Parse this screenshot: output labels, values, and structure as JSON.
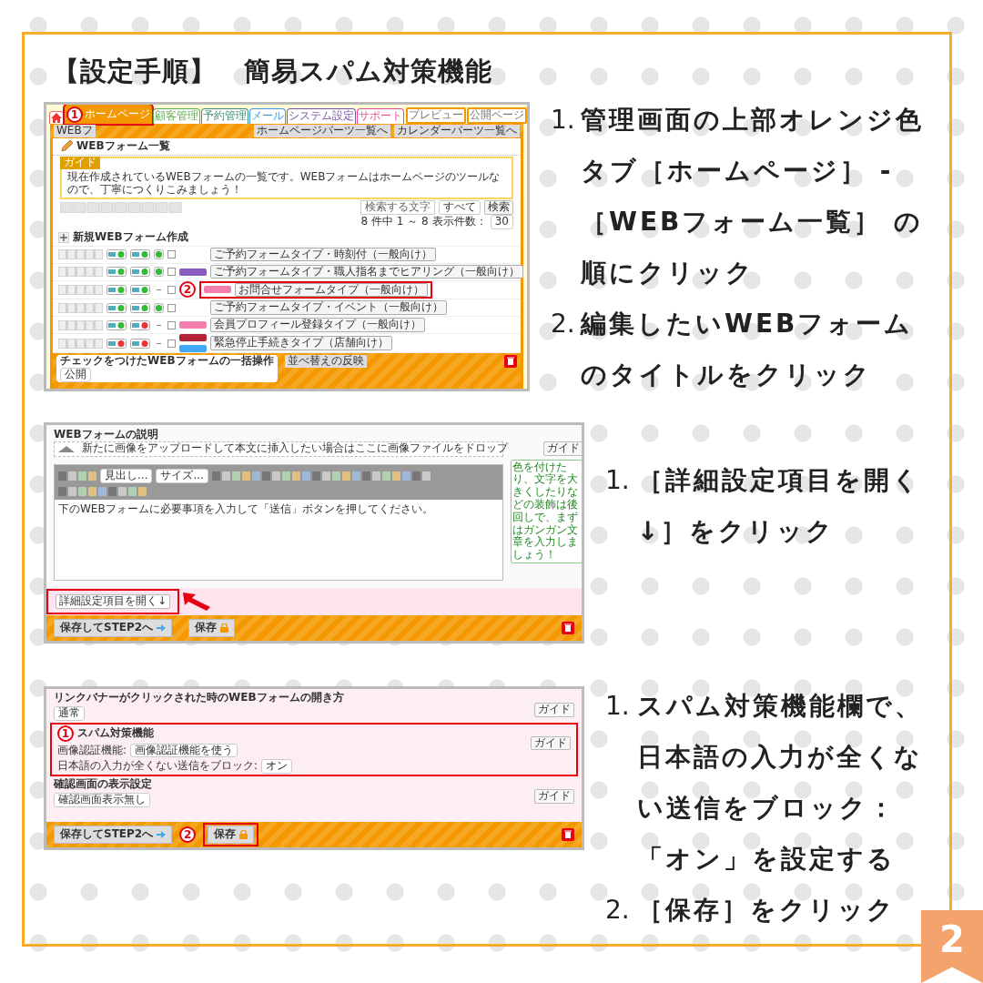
{
  "title": "【設定手順】　簡易スパム対策機能",
  "sections": [
    {
      "screen": {
        "kind": "form_list",
        "tabs": [
          {
            "kind": "home",
            "selected": false
          },
          {
            "kind": "text",
            "label": "ホームページ",
            "selected": true,
            "color": "#f39800",
            "marker": "1"
          },
          {
            "kind": "text",
            "label": "顧客管理",
            "selected": false,
            "color": "#5cae4a"
          },
          {
            "kind": "text",
            "label": "予約管理",
            "selected": false,
            "color": "#3f8f7a"
          },
          {
            "kind": "text",
            "label": "メール",
            "selected": false,
            "color": "#3c9ee0"
          },
          {
            "kind": "text",
            "label": "システム設定",
            "selected": false,
            "color": "#7a55a8"
          },
          {
            "kind": "text",
            "label": "サポート",
            "selected": false,
            "color": "#e8518f"
          }
        ],
        "header_buttons": [
          "プレビュー",
          "公開ページ"
        ],
        "breadcrumb": "WEBフ",
        "part_links": [
          "ホームページパーツ一覧へ",
          "カレンダーパーツ一覧へ"
        ],
        "heading": "WEBフォーム一覧",
        "guide": {
          "label": "ガイド",
          "text": "現在作成されているWEBフォームの一覧です。WEBフォームはホームページのツールなので、丁寧につくりこみましょう！"
        },
        "search": {
          "placeholder": "検索する文字",
          "scope": "すべて",
          "button": "検索"
        },
        "count": "8 件中 1 ～ 8",
        "per_page_label": "表示件数：",
        "per_page": "30",
        "new_form": "新規WEBフォーム作成",
        "rows": [
          {
            "title": "ご予約フォームタイプ・時刻付（一般向け）",
            "checked": false,
            "mail_user": true,
            "mail_admin": true,
            "published": true
          },
          {
            "title": "ご予約フォームタイプ・職人指名までヒアリング（一般向け）",
            "checked": false,
            "mail_user": true,
            "mail_admin": true,
            "published": true,
            "labels": [
              {
                "color": "#8a5cc0"
              }
            ]
          },
          {
            "title": "お問合せフォームタイプ（一般向け）",
            "checked": false,
            "mail_user": true,
            "mail_admin": true,
            "published": false,
            "labels": [
              {
                "color": "#f27fae"
              }
            ],
            "marker": "2"
          },
          {
            "title": "ご予約フォームタイプ・イベント（一般向け）",
            "checked": false,
            "mail_user": true,
            "mail_admin": true,
            "published": true
          },
          {
            "title": "会員プロフィール登録タイプ（一般向け）",
            "checked": false,
            "mail_user": true,
            "mail_admin": false,
            "published": false,
            "labels": [
              {
                "color": "#f27fae"
              }
            ]
          },
          {
            "title": "緊急停止手続きタイプ（店舗向け）",
            "checked": false,
            "mail_user": false,
            "mail_admin": false,
            "published": false,
            "labels": [
              {
                "color": "#b22234"
              },
              {
                "color": "#3fa9f5"
              }
            ]
          }
        ],
        "bulk": {
          "title": "チェックをつけたWEBフォームの一括操作",
          "status": "公開"
        },
        "reorder": "並べ替えの反映"
      },
      "steps": [
        {
          "number": "1.",
          "text": "管理画面の上部オレンジ色タブ［ホームページ］ - ［WEBフォーム一覧］ の順にクリック"
        },
        {
          "number": "2.",
          "text": "編集したいWEBフォームのタイトルをクリック"
        }
      ]
    },
    {
      "screen": {
        "kind": "description_editor",
        "heading": "WEBフォームの説明",
        "drop_zone": "新たに画像をアップロードして本文に挿入したい場合はここに画像ファイルをドロップ",
        "guide": "ガイド",
        "format_select": "見出し...",
        "size_select": "サイズ...",
        "body": "下のWEBフォームに必要事項を入力して「送信」ボタンを押してください。",
        "tip": "色を付けたり、文字を大きくしたりなどの装飾は後回しで、まずはガンガン文章を入力しましょう！",
        "detail_button": {
          "label": "詳細設定項目を開く↓",
          "highlighted": true
        },
        "footer": {
          "next": "保存してSTEP2へ",
          "save": "保存"
        }
      },
      "steps": [
        {
          "number": "1.",
          "text": "［詳細設定項目を開く↓］をクリック"
        }
      ]
    },
    {
      "screen": {
        "kind": "detail_settings",
        "settings": [
          {
            "kind": "select",
            "label": "リンクバナーがクリックされた時のWEBフォームの開き方",
            "value": "通常",
            "guide": "ガイド"
          },
          {
            "kind": "group",
            "label": "スパム対策機能",
            "marker": "1",
            "guide": "ガイド",
            "fields": [
              {
                "label": "画像認証機能:",
                "value": "画像認証機能を使う"
              },
              {
                "label": "日本語の入力が全くない送信をブロック:",
                "value": "オン"
              }
            ]
          },
          {
            "kind": "select",
            "label": "確認画面の表示設定",
            "value": "確認画面表示無し",
            "guide": "ガイド"
          }
        ],
        "footer": {
          "next": "保存してSTEP2へ",
          "save": "保存",
          "save_marker": "2"
        }
      },
      "steps": [
        {
          "number": "1.",
          "text": "スパム対策機能欄で、日本語の入力が全くない送信をブロック：「オン」を設定する"
        },
        {
          "number": "2.",
          "text": "［保存］をクリック"
        }
      ]
    }
  ],
  "page_number": "2"
}
